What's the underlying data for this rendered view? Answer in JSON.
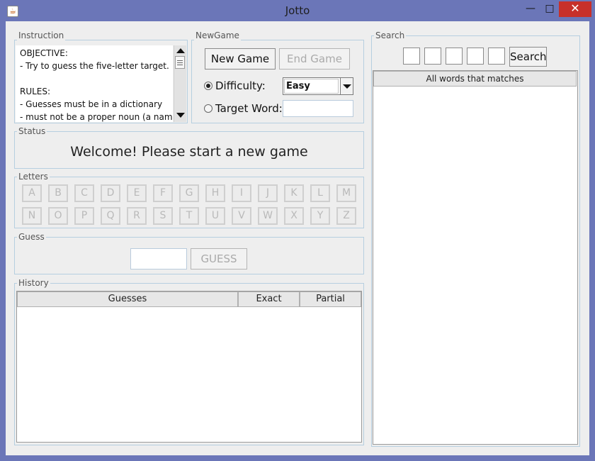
{
  "window": {
    "title": "Jotto",
    "minimize": "—",
    "maximize": "□",
    "close": "✕"
  },
  "instruction": {
    "legend": "Instruction",
    "lines": [
      "OBJECTIVE:",
      "- Try to guess the five-letter target.",
      "",
      "RULES:",
      "- Guesses must be in a dictionary",
      "- must not be a proper noun (a name),"
    ]
  },
  "newgame": {
    "legend": "NewGame",
    "new_game": "New Game",
    "end_game": "End Game",
    "difficulty_label": "Difficulty:",
    "difficulty_value": "Easy",
    "target_label": "Target Word:",
    "target_value": "",
    "selected_mode": "difficulty"
  },
  "status": {
    "legend": "Status",
    "message": "Welcome! Please start a new game"
  },
  "letters": {
    "legend": "Letters",
    "row1": [
      "A",
      "B",
      "C",
      "D",
      "E",
      "F",
      "G",
      "H",
      "I",
      "J",
      "K",
      "L",
      "M"
    ],
    "row2": [
      "N",
      "O",
      "P",
      "Q",
      "R",
      "S",
      "T",
      "U",
      "V",
      "W",
      "X",
      "Y",
      "Z"
    ]
  },
  "guess": {
    "legend": "Guess",
    "input_value": "",
    "button": "GUESS"
  },
  "history": {
    "legend": "History",
    "columns": [
      "Guesses",
      "Exact",
      "Partial"
    ],
    "rows": []
  },
  "search": {
    "legend": "Search",
    "slots": [
      "",
      "",
      "",
      "",
      ""
    ],
    "button": "Search",
    "results_header": "All words that matches",
    "results": []
  },
  "icons": {
    "app": "java-icon",
    "scroll_up": "arrow-up-icon",
    "scroll_down": "arrow-down-icon",
    "dropdown": "chevron-down-icon"
  }
}
